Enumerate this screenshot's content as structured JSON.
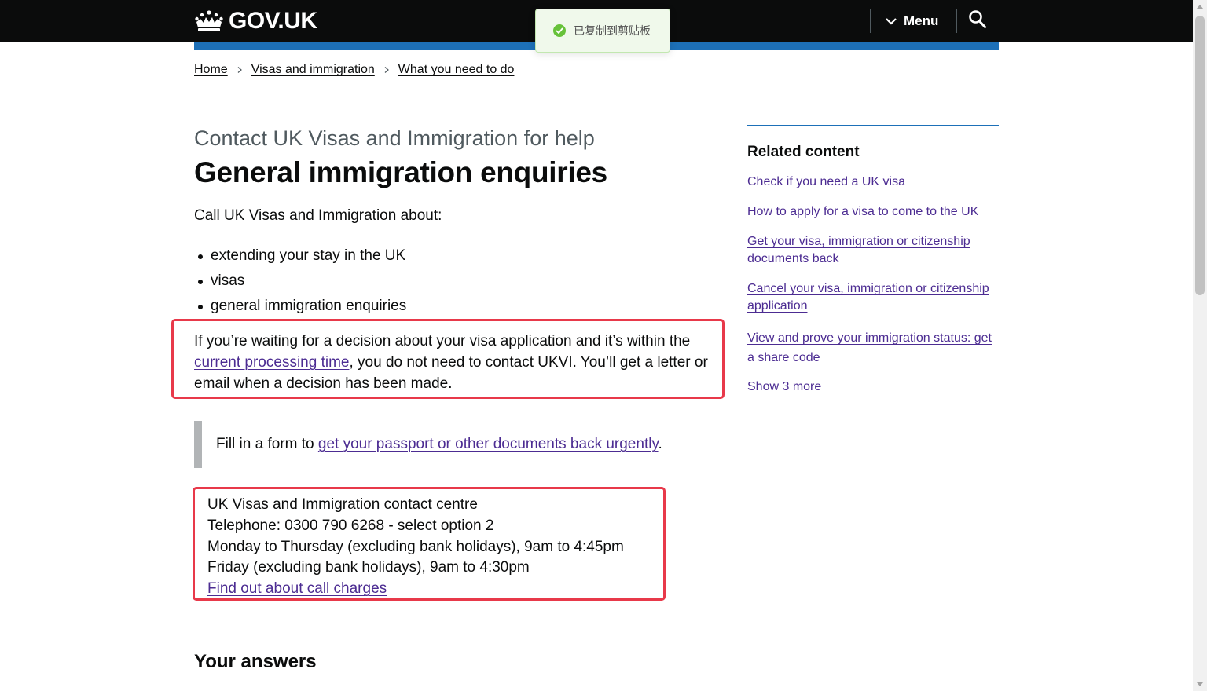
{
  "header": {
    "logo_text": "GOV.UK",
    "menu_label": "Menu"
  },
  "toast": {
    "text": "已复制到剪贴板"
  },
  "breadcrumb": [
    {
      "label": "Home"
    },
    {
      "label": "Visas and immigration"
    },
    {
      "label": "What you need to do"
    }
  ],
  "main": {
    "caption": "Contact UK Visas and Immigration for help",
    "title": "General immigration enquiries",
    "intro": "Call UK Visas and Immigration about:",
    "bullets": [
      "extending your stay in the UK",
      "visas",
      "general immigration enquiries"
    ],
    "decision_paragraph": {
      "before": "If you’re waiting for a decision about your visa application and it’s within the ",
      "link": "current processing time",
      "after": ", you do not need to contact UKVI. You’ll get a letter or email when a decision has been made."
    },
    "inset": {
      "before": "Fill in a form to ",
      "link": "get your passport or other documents back urgently",
      "after": "."
    },
    "contact": {
      "name": "UK Visas and Immigration contact centre",
      "telephone": "Telephone: 0300 790 6268 - select option 2",
      "hours_mon_thu": "Monday to Thursday (excluding bank holidays), 9am to 4:45pm",
      "hours_fri": "Friday (excluding bank holidays), 9am to 4:30pm",
      "call_charges_link": "Find out about call charges"
    },
    "your_answers_heading": "Your answers"
  },
  "related": {
    "heading": "Related content",
    "links": [
      "Check if you need a UK visa",
      "How to apply for a visa to come to the UK",
      "Get your visa, immigration or citizenship documents back",
      "Cancel your visa, immigration or citizenship application",
      "View and prove your immigration status: get a share code",
      "Show 3 more"
    ]
  },
  "colors": {
    "header_bg": "#0b0c0c",
    "accent_blue": "#1d70b8",
    "link": "#4c2c92",
    "highlight_red": "#e8394a",
    "toast_success": "#67c23a"
  }
}
